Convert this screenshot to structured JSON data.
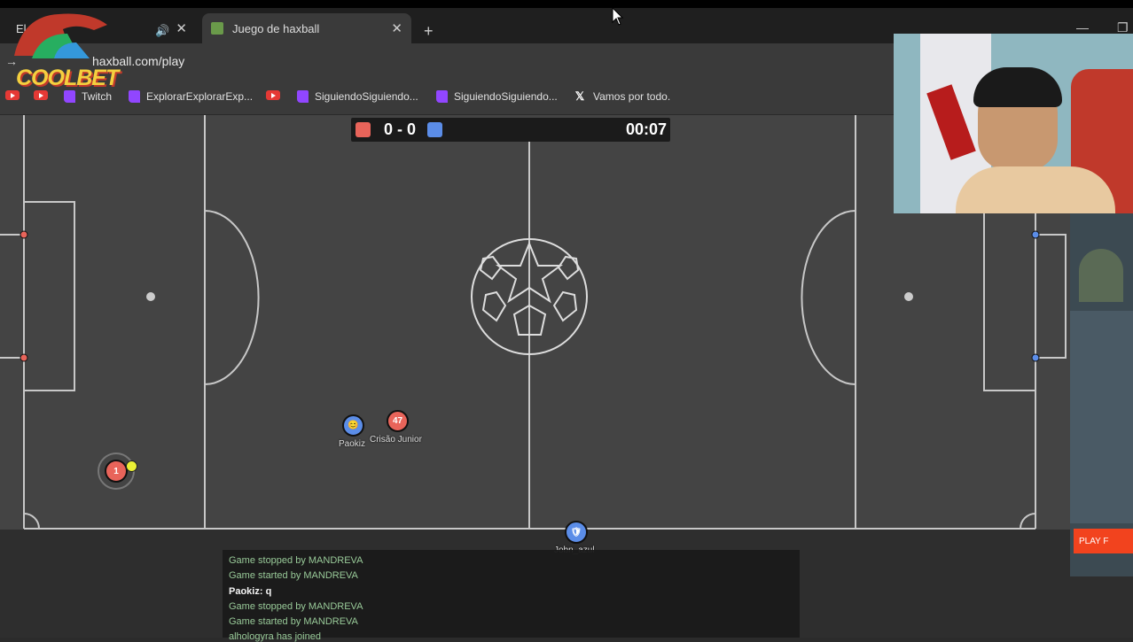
{
  "browser": {
    "tabs": [
      {
        "label": "El",
        "active": false
      },
      {
        "label": "Juego de haxball",
        "active": true
      }
    ],
    "url": "haxball.com/play",
    "bookmarks": [
      {
        "icon": "youtube-icon",
        "label": ""
      },
      {
        "icon": "youtube-icon",
        "label": ""
      },
      {
        "icon": "twitch-icon",
        "label": "Twitch"
      },
      {
        "icon": "twitch-icon",
        "label": "ExplorarExplorarExp..."
      },
      {
        "icon": "youtube-icon",
        "label": ""
      },
      {
        "icon": "twitch-icon",
        "label": "SiguiendoSiguiendo..."
      },
      {
        "icon": "twitch-icon",
        "label": "SiguiendoSiguiendo..."
      },
      {
        "icon": "x-icon",
        "label": "Vamos por todo."
      }
    ]
  },
  "overlay": {
    "logo_text": "COOLBET",
    "ad_button": "PLAY F"
  },
  "game": {
    "score": "0 - 0",
    "timer": "00:07",
    "red_color": "#e8645a",
    "blue_color": "#5b8de8",
    "players": [
      {
        "name": "Paokiz",
        "team": "blue",
        "avatar": "😊"
      },
      {
        "name": "Crisão Junior",
        "team": "red",
        "avatar": "47"
      },
      {
        "name": "",
        "team": "red",
        "avatar": "1"
      },
      {
        "name": "Jobn_azul",
        "team": "blue",
        "avatar": "🛡"
      }
    ]
  },
  "chat": [
    {
      "text": "Game stopped by MANDREVA",
      "kind": "system"
    },
    {
      "text": "Game started by MANDREVA",
      "kind": "system"
    },
    {
      "text": "Paokiz: q",
      "kind": "user"
    },
    {
      "text": "Game stopped by MANDREVA",
      "kind": "system"
    },
    {
      "text": "Game started by MANDREVA",
      "kind": "system"
    },
    {
      "text": "alhologyra has joined",
      "kind": "system"
    }
  ]
}
